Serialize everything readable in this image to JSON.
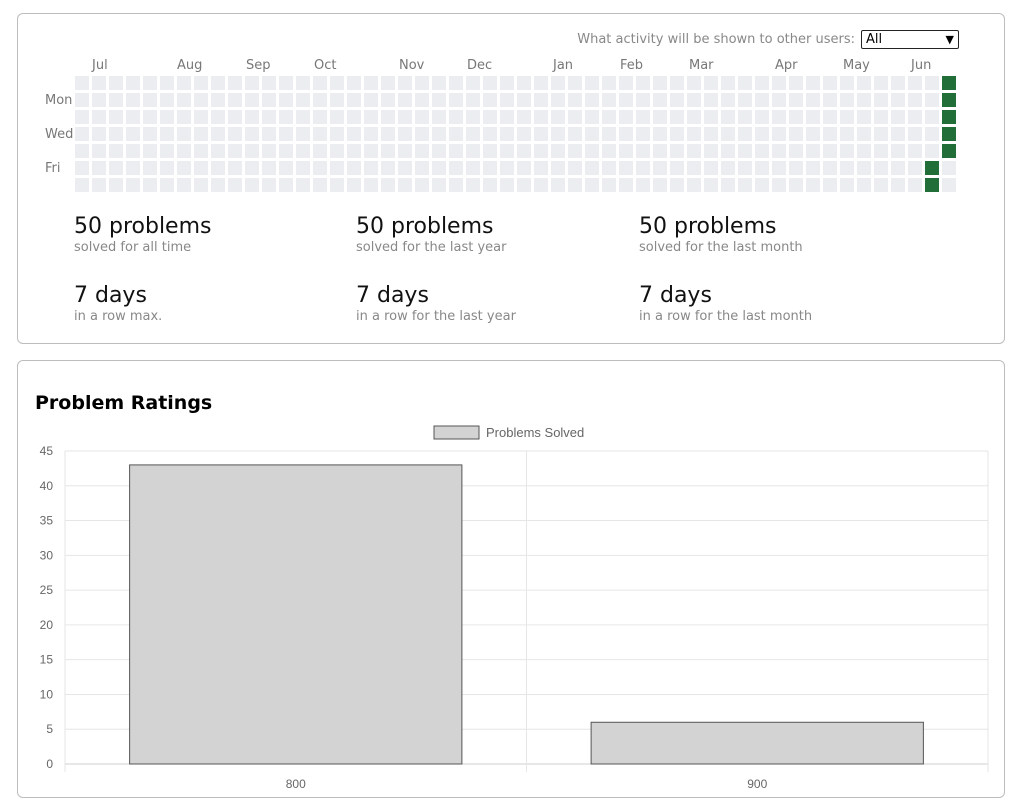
{
  "activity": {
    "visibility_label": "What activity will be shown to other users:",
    "visibility_value": "All",
    "months": [
      "Jul",
      "Aug",
      "Sep",
      "Oct",
      "Nov",
      "Dec",
      "Jan",
      "Feb",
      "Mar",
      "Apr",
      "May",
      "Jun"
    ],
    "day_labels": [
      "Mon",
      "Wed",
      "Fri"
    ],
    "active_days": [
      {
        "week": 51,
        "day": 0
      },
      {
        "week": 51,
        "day": 1
      },
      {
        "week": 51,
        "day": 2
      },
      {
        "week": 51,
        "day": 3
      },
      {
        "week": 51,
        "day": 4
      },
      {
        "week": 50,
        "day": 5
      },
      {
        "week": 50,
        "day": 6
      }
    ],
    "stats": [
      {
        "value": "50 problems",
        "caption": "solved for all time"
      },
      {
        "value": "50 problems",
        "caption": "solved for the last year"
      },
      {
        "value": "50 problems",
        "caption": "solved for the last month"
      },
      {
        "value": "7 days",
        "caption": "in a row max."
      },
      {
        "value": "7 days",
        "caption": "in a row for the last year"
      },
      {
        "value": "7 days",
        "caption": "in a row for the last month"
      }
    ]
  },
  "ratings": {
    "title": "Problem Ratings"
  },
  "chart_data": {
    "type": "bar",
    "categories": [
      "800",
      "900"
    ],
    "series": [
      {
        "name": "Problems Solved",
        "values": [
          43,
          6
        ]
      }
    ],
    "ylim": [
      0,
      45
    ],
    "yticks": [
      0,
      5,
      10,
      15,
      20,
      25,
      30,
      35,
      40,
      45
    ],
    "grid": true,
    "legend": "top-center",
    "bar_color": "#d3d3d3",
    "bar_border": "#555555"
  },
  "colors": {
    "active": "#216e39",
    "empty": "#ebedf0"
  }
}
